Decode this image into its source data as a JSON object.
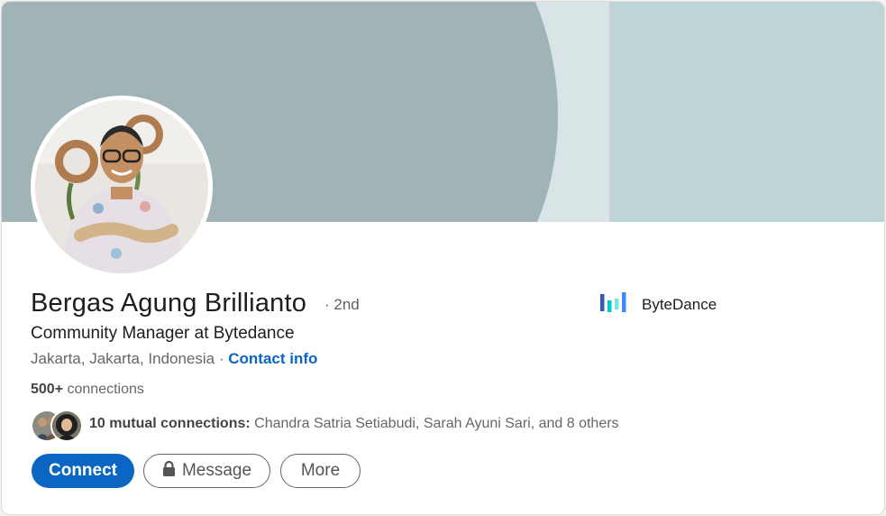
{
  "profile": {
    "name": "Bergas Agung Brillianto",
    "degree": "· 2nd",
    "headline": "Community Manager at Bytedance",
    "location": "Jakarta, Jakarta, Indonesia",
    "separator": " · ",
    "contact_info": "Contact info",
    "connections_count": "500+",
    "connections_label": " connections"
  },
  "mutual": {
    "count_label": "10 mutual connections:",
    "names": " Chandra Satria Setiabudi, Sarah Ayuni Sari, and 8 others"
  },
  "actions": {
    "connect": "Connect",
    "message": "Message",
    "more": "More"
  },
  "company": {
    "name": "ByteDance",
    "logo_icon": "bytedance-logo-icon"
  },
  "colors": {
    "accent": "#0a66c2",
    "banner_dark": "#a0b3b7",
    "banner_light": "#d8e4e6",
    "banner_right": "#bed4d6"
  }
}
